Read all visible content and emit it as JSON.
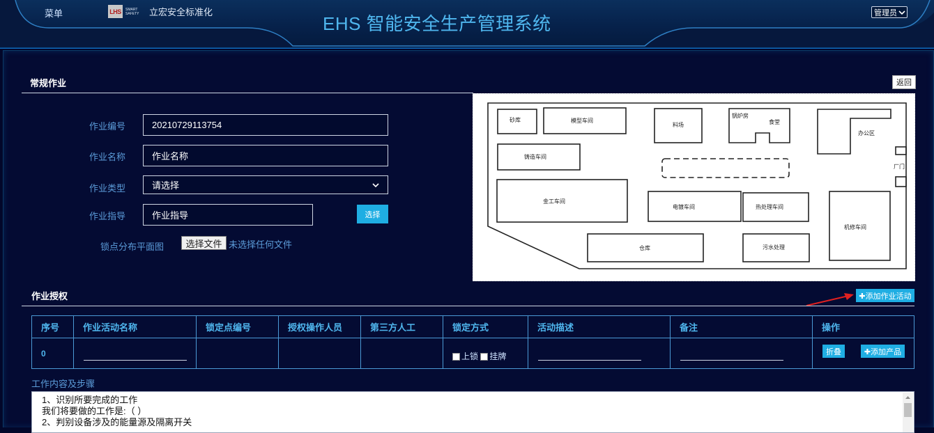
{
  "header": {
    "menu_label": "菜单",
    "logo_mark": "LHS",
    "logo_small": "SMART SAFETY",
    "logo_text": "立宏安全标准化",
    "system_title": "EHS 智能安全生产管理系统",
    "user_select": "管理员"
  },
  "routine": {
    "title": "常规作业",
    "back_label": "返回",
    "fields": {
      "job_no_label": "作业编号",
      "job_no_value": "20210729113754",
      "job_name_label": "作业名称",
      "job_name_value": "作业名称",
      "job_type_label": "作业类型",
      "job_type_value": "请选择",
      "guide_label": "作业指导",
      "guide_value": "作业指导",
      "choose_label": "选择",
      "lockpoint_label": "锁点分布平面图",
      "file_button": "选择文件",
      "file_status": "未选择任何文件"
    },
    "floorplan": {
      "rooms": [
        "砂库",
        "模型车间",
        "料场",
        "锅炉房",
        "食堂",
        "办公区",
        "铸造车间",
        "厂门",
        "金工车间",
        "电镀车间",
        "热处理车间",
        "机修车间",
        "仓库",
        "污水处理"
      ]
    }
  },
  "auth": {
    "title": "作业授权",
    "add_activity_label": "✚添加作业活动",
    "columns": [
      "序号",
      "作业活动名称",
      "锁定点编号",
      "授权操作人员",
      "第三方人工",
      "锁定方式",
      "活动描述",
      "备注",
      "操作"
    ],
    "rows": [
      {
        "index": "0",
        "lock_opt1": "上锁",
        "lock_opt2": "挂牌",
        "fold_label": "折叠",
        "add_product_label": "✚添加产品"
      }
    ]
  },
  "steps": {
    "label": "工作内容及步骤",
    "lines": [
      "1、识别所要完成的工作",
      "我们将要做的工作是:（                              ）",
      "2、判别设备涉及的能量源及隔离开关"
    ]
  },
  "colors": {
    "title_blue": "#4fb6ee",
    "label_blue": "#5b9bd8",
    "button_blue": "#1faee3",
    "bg": "#02072a",
    "arrow_red": "#e02020"
  }
}
